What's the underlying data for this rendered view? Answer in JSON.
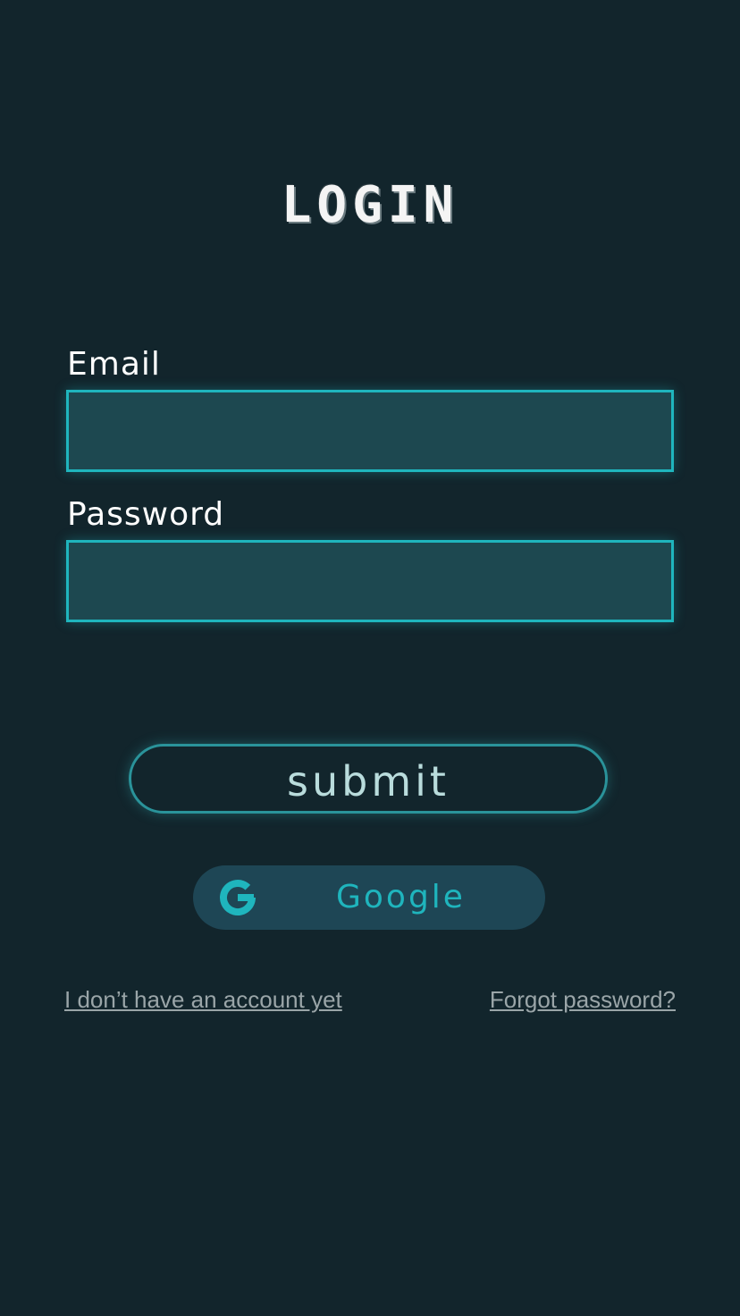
{
  "header": {
    "title": "LOGIN"
  },
  "form": {
    "email_label": "Email",
    "email_value": "",
    "password_label": "Password",
    "password_value": "",
    "submit_label": "submit"
  },
  "social": {
    "google_label": "Google",
    "google_icon": "google-g-icon"
  },
  "links": {
    "signup": "I don’t have an account yet",
    "forgot": "Forgot password?"
  },
  "colors": {
    "background": "#12252c",
    "accent": "#1fb5bd",
    "input_fill": "#1d4850",
    "google_button": "#1e4655",
    "link_text": "#9aa5a8"
  }
}
